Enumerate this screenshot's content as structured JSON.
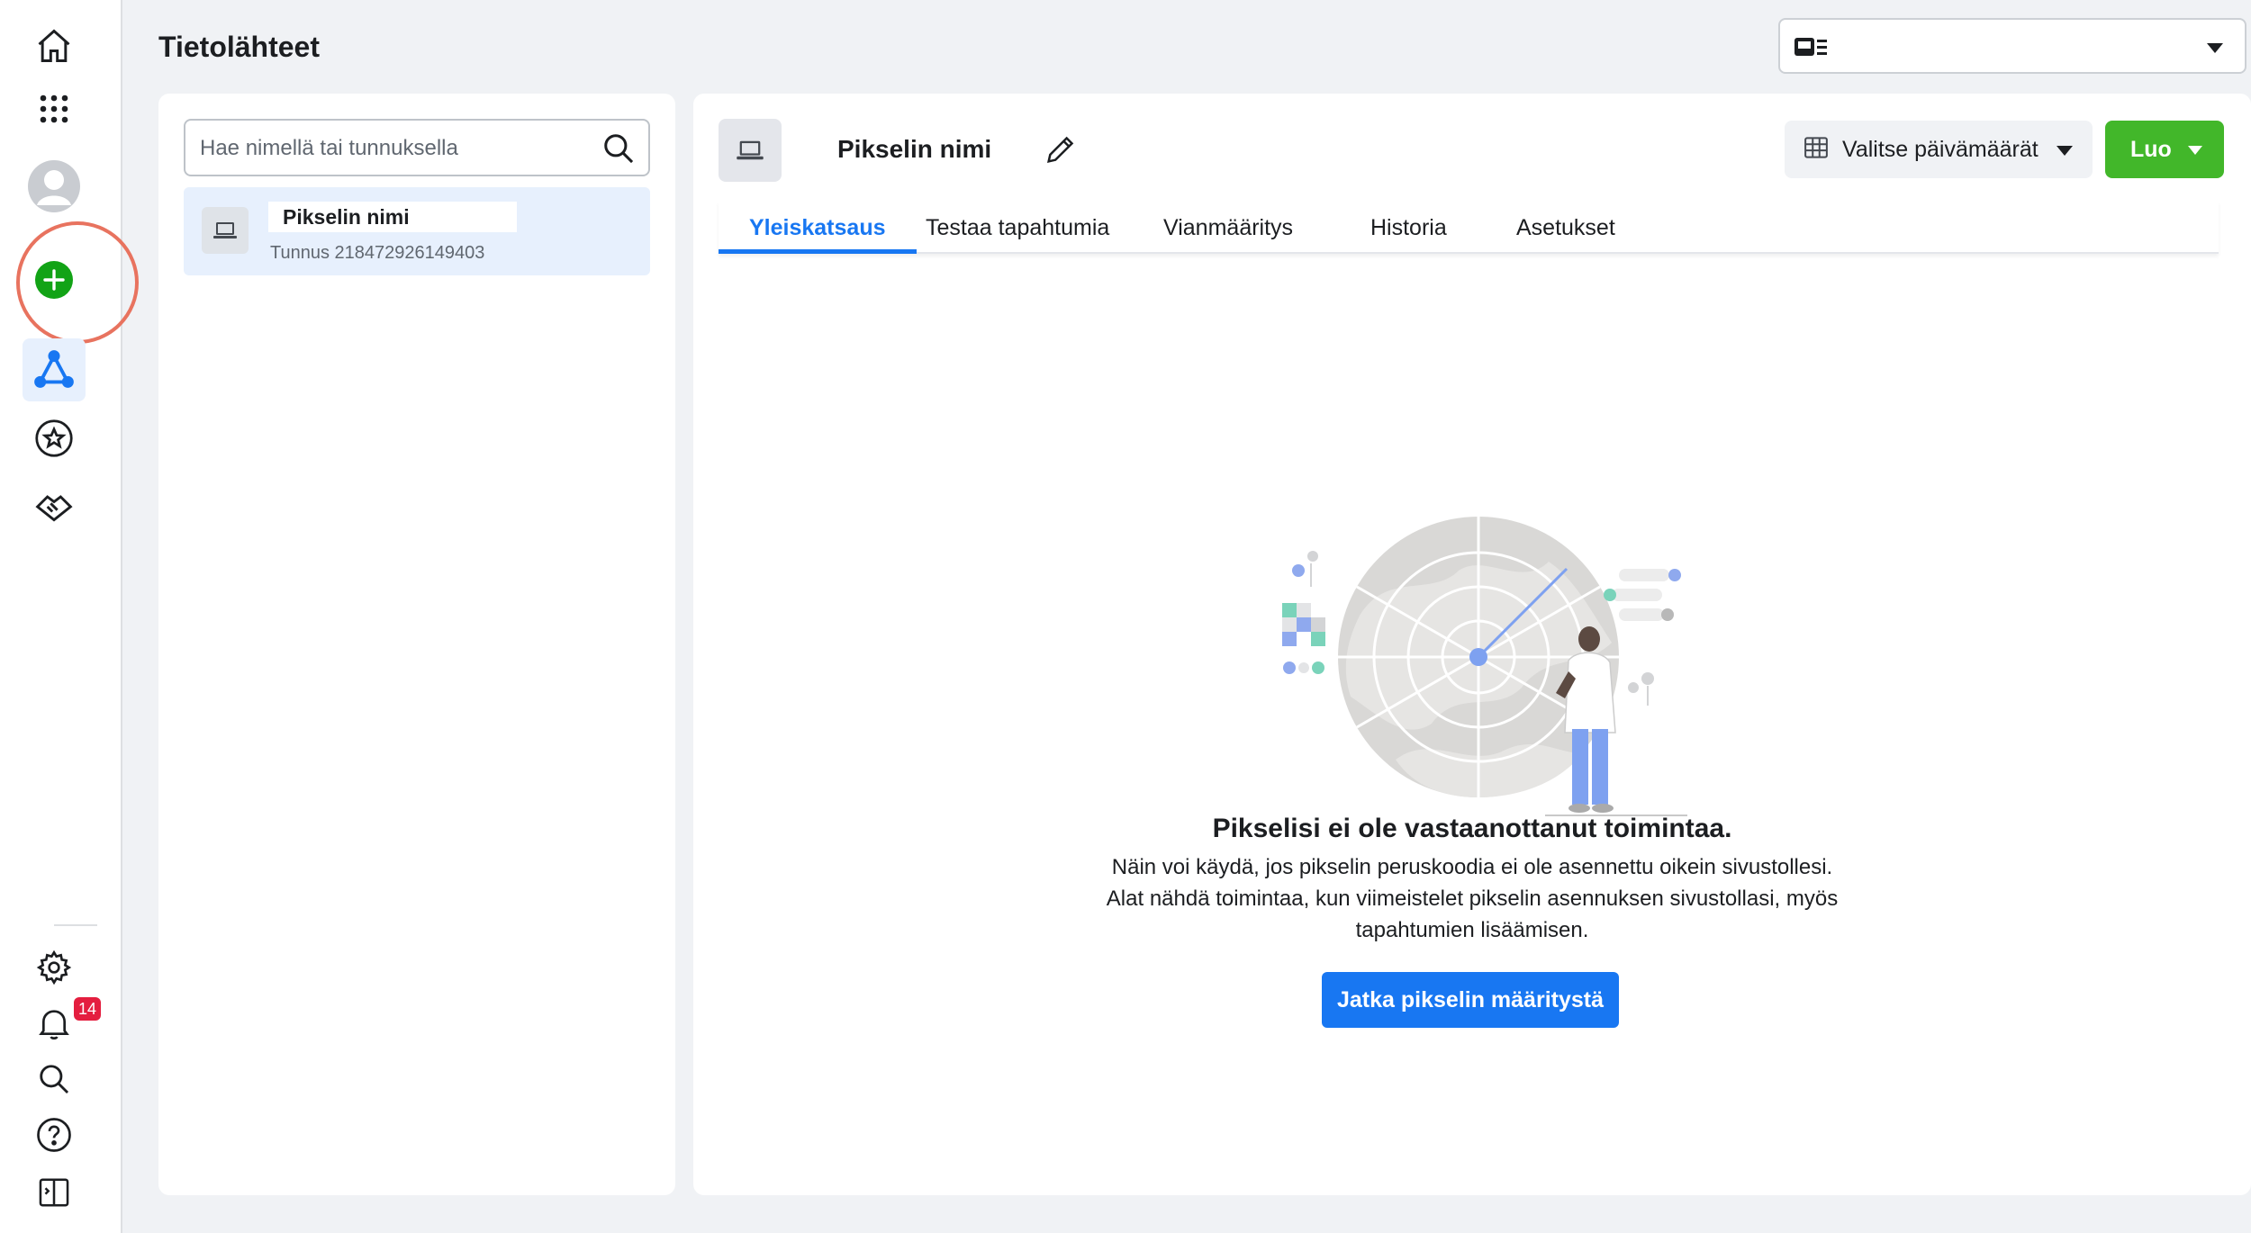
{
  "header": {
    "title": "Tietolähteet"
  },
  "rail": {
    "notification_count": "14",
    "items": [
      {
        "icon": "home-icon"
      },
      {
        "icon": "apps-grid-icon"
      },
      {
        "icon": "avatar"
      },
      {
        "icon": "add-icon"
      },
      {
        "icon": "data-sources-icon"
      },
      {
        "icon": "star-icon"
      },
      {
        "icon": "handshake-icon"
      },
      {
        "icon": "gear-icon"
      },
      {
        "icon": "bell-icon"
      },
      {
        "icon": "search-icon"
      },
      {
        "icon": "help-icon"
      },
      {
        "icon": "panel-icon"
      }
    ]
  },
  "left_panel": {
    "search_placeholder": "Hae nimellä tai tunnuksella",
    "selected_item": {
      "name": "Pikselin nimi",
      "id": "Tunnus 218472926149403"
    }
  },
  "main": {
    "title": "Pikselin nimi",
    "date_picker_label": "Valitse päivämäärät",
    "create_label": "Luo",
    "tabs": [
      {
        "label": "Yleiskatsaus",
        "active": true
      },
      {
        "label": "Testaa tapahtumia",
        "active": false
      },
      {
        "label": "Vianmääritys",
        "active": false
      },
      {
        "label": "Historia",
        "active": false
      },
      {
        "label": "Asetukset",
        "active": false
      }
    ],
    "empty_state": {
      "title": "Pikselisi ei ole vastaanottanut toimintaa.",
      "line1": "Näin voi käydä, jos pikselin peruskoodia ei ole asennettu oikein sivustollesi.",
      "line2": "Alat nähdä toimintaa, kun viimeistelet pikselin asennuksen sivustollasi, myös",
      "line3": "tapahtumien lisäämisen.",
      "button": "Jatka pikselin määritystä"
    }
  },
  "colors": {
    "accent": "#1877f2",
    "create": "#42b72a",
    "add": "#12a316",
    "highlight_ring": "#e8735f",
    "badge": "#e41e3f"
  }
}
